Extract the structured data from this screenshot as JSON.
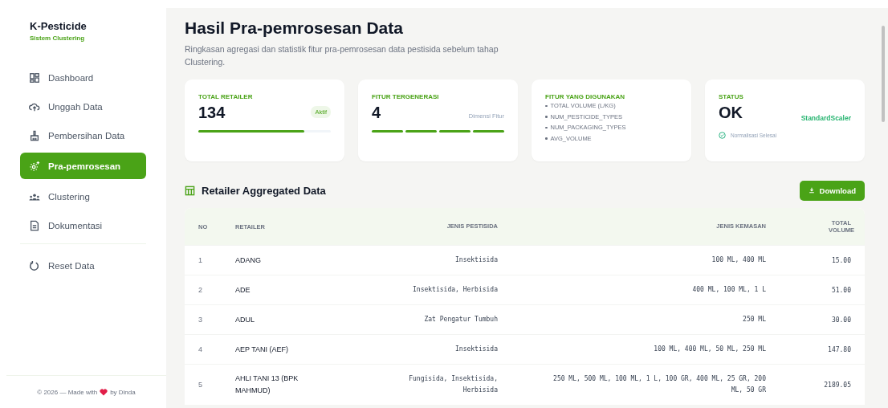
{
  "brand": {
    "title": "K-Pesticide",
    "subtitle": "Sistem Clustering"
  },
  "nav": [
    {
      "label": "Dashboard",
      "selected": false
    },
    {
      "label": "Unggah Data",
      "selected": false
    },
    {
      "label": "Pembersihan Data",
      "selected": false
    },
    {
      "label": "Pra-pemrosesan",
      "selected": true
    },
    {
      "label": "Clustering",
      "selected": false
    },
    {
      "label": "Dokumentasi",
      "selected": false
    }
  ],
  "reset": {
    "label": "Reset Data"
  },
  "footer": {
    "left": "© 2026 — Made with",
    "right": "by Dinda"
  },
  "page": {
    "title": "Hasil Pra-pemrosesan Data",
    "subtitle": "Ringkasan agregasi dan statistik fitur pra-pemrosesan data pestisida sebelum tahap Clustering."
  },
  "cards": [
    {
      "kind": "progress",
      "label": "TOTAL RETAILER",
      "value": "134",
      "badge": "Aktif",
      "level": 0.8
    },
    {
      "kind": "segments",
      "label": "FITUR TERGENERASI",
      "value": "4",
      "note": "Dimensi Fitur"
    },
    {
      "kind": "list",
      "label": "FITUR YANG DIGUNAKAN",
      "items": [
        "TOTAL VOLUME (L/KG)",
        "NUM_PESTICIDE_TYPES",
        "NUM_PACKAGING_TYPES",
        "AVG_VOLUME"
      ]
    },
    {
      "kind": "status",
      "label": "STATUS",
      "value": "OK",
      "note": "StandardScaler",
      "status": "Normalisasi Selesai"
    }
  ],
  "table": {
    "title": "Retailer Aggregated Data",
    "download": "Download",
    "columns": [
      "NO",
      "RETAILER",
      "JENIS PESTISIDA",
      "JENIS KEMASAN",
      "TOTAL VOLUME"
    ],
    "rows": [
      [
        "1",
        "ADANG",
        "Insektisida",
        "100 ML, 400 ML",
        "15.00"
      ],
      [
        "2",
        "ADE",
        "Insektisida, Herbisida",
        "400 ML, 100 ML, 1 L",
        "51.00"
      ],
      [
        "3",
        "ADUL",
        "Zat Pengatur Tumbuh",
        "250 ML",
        "30.00"
      ],
      [
        "4",
        "AEP TANI (AEF)",
        "Insektisida",
        "100 ML, 400 ML, 50 ML, 250 ML",
        "147.80"
      ],
      [
        "5",
        "AHLI TANI 13 (BPK MAHMUD)",
        "Fungisida, Insektisida, Herbisida",
        "250 ML, 500 ML, 100 ML, 1 L, 100 GR, 400 ML, 25 GR, 200 ML, 50 GR",
        "2189.05"
      ]
    ]
  }
}
